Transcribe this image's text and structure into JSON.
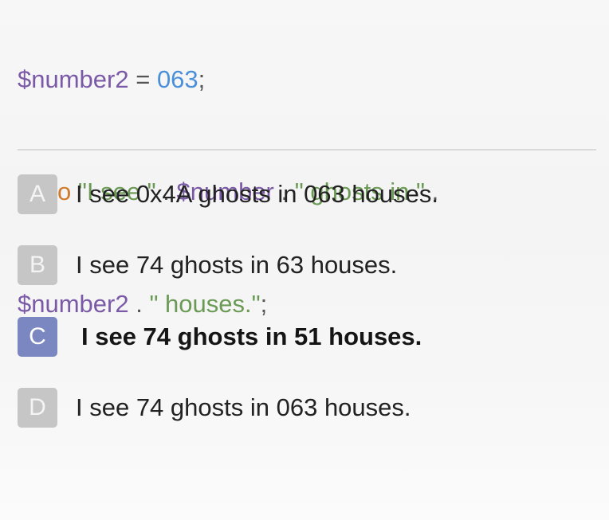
{
  "code": {
    "line1": {
      "var": "$number2",
      "op": " = ",
      "num": "063",
      "end": ";"
    },
    "line2": {
      "kw": "echo",
      "str1": " \"I see \"",
      "op1": " . ",
      "var": "$number",
      "op2": " . ",
      "str2": "\" ghosts in \"",
      "op3": " ."
    },
    "line3": {
      "var": "$number2",
      "op": " . ",
      "str": "\" houses.\"",
      "end": ";"
    }
  },
  "options": [
    {
      "letter": "A",
      "text": "I see 0x4A ghosts in 063 houses.",
      "selected": false
    },
    {
      "letter": "B",
      "text": "I see 74 ghosts in 63 houses.",
      "selected": false
    },
    {
      "letter": "C",
      "text": "I see 74 ghosts in 51 houses.",
      "selected": true
    },
    {
      "letter": "D",
      "text": "I see 74 ghosts in 063 houses.",
      "selected": false
    }
  ],
  "colors": {
    "badge_default": "#c6c6c6",
    "badge_selected": "#7b87c0",
    "code_variable": "#7a5aa6",
    "code_number": "#4a90d9",
    "code_keyword": "#d07a2e",
    "code_string": "#6a9a54"
  }
}
